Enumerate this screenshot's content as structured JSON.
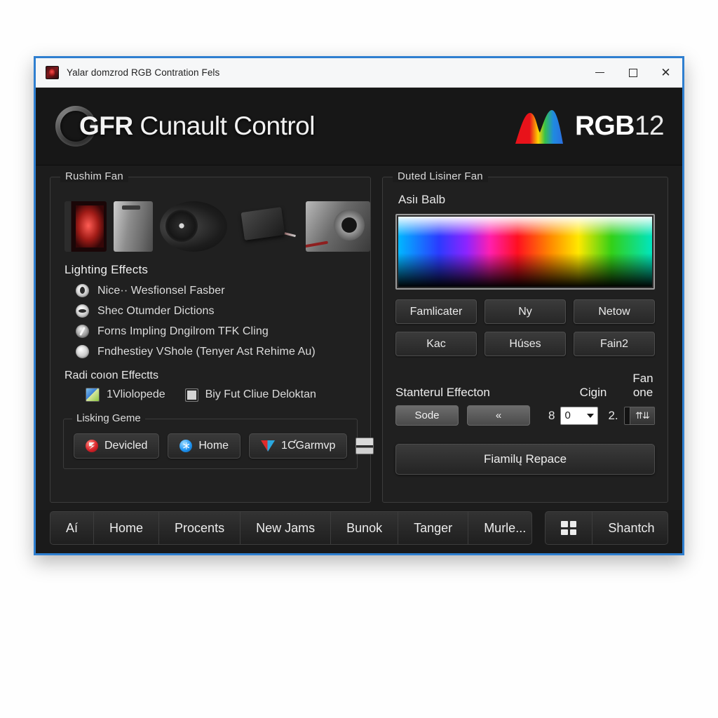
{
  "window": {
    "title": "Yalar domzrod RGB Contration Fels",
    "icon": "app-icon",
    "controls": {
      "minimize": "–",
      "maximize": "□",
      "close": "✕"
    },
    "accent_border": "#2f7fd0"
  },
  "header": {
    "brand_mark": "GFR",
    "brand_title": "Cunault Control",
    "logo_right_text": "RGB",
    "logo_right_num": "12",
    "logo_right_icon": "rgb-mountain-logo"
  },
  "left_panel": {
    "legend": "Rushim Fan",
    "thumbnails": [
      "pc-case-red-lit-thumbnail",
      "silver-case-thumbnail",
      "case-fan-thumbnail",
      "rgb-controller-thumbnail",
      "power-supply-thumbnail"
    ],
    "lighting_effects_heading": "Lighting Effects",
    "options": [
      {
        "label": "Nice·· Wesfionsel Fasber",
        "icon": "radio-option-icon"
      },
      {
        "label": "Shec Otumder Dictions",
        "icon": "radio-option-icon"
      },
      {
        "label": "Forns Impling Dngilrom TFK Cling",
        "icon": "radio-option-icon"
      },
      {
        "label": "Fndhestiey VShole (Tenyer Ast Rehime Au)",
        "icon": "radio-option-icon"
      }
    ],
    "radiation_heading": "Radi coıon Effectts",
    "checks": [
      {
        "label": "1Vliolopede",
        "icon": "image-swatch-icon"
      },
      {
        "label": "Biy Fut Cliue Deloktan",
        "icon": "checkbox-icon"
      }
    ],
    "inner_group": {
      "legend": "Lisking Geme",
      "buttons": [
        {
          "label": "Devicled",
          "icon": "red-power-icon"
        },
        {
          "label": "Home",
          "icon": "blue-asterisk-icon"
        },
        {
          "label": "1ƇGarmvp",
          "icon": "triangle-icon"
        }
      ],
      "extra_icon": "keyboard-icon"
    }
  },
  "right_panel": {
    "legend": "Duted Lisiner Fan",
    "color_field_label": "Asiı Balb",
    "color_picker": {
      "name": "color-gradient-swatch",
      "stops": [
        "#00b7ff",
        "#2b3bff",
        "#8e24ff",
        "#ff1fb0",
        "#ff1020",
        "#ff8a00",
        "#ffe800",
        "#33d017",
        "#00e5c0"
      ]
    },
    "preset_buttons": [
      "Famlicater",
      "Ny",
      "Netow",
      "Kac",
      "Húses",
      "Fain2"
    ],
    "controls": {
      "label_effect": "Stanterul Effecton",
      "label_cigin": "Cigin",
      "label_fan": "Fan one",
      "button_mode": "Sode",
      "button_prev": "«",
      "number_left": "8",
      "combo_value": "0",
      "number_right": "2.",
      "spinner_value": "",
      "spinner_icon": "spinner-arrows-icon"
    },
    "apply_button": "Fiamilų Repace"
  },
  "navbar": {
    "group_one": [
      "Aí",
      "Home",
      "Procents",
      "New Jams",
      "Bunok",
      "Tanger",
      "Murle..."
    ],
    "group_two": {
      "icon": "grid-view-icon",
      "label": "Shantch"
    }
  }
}
